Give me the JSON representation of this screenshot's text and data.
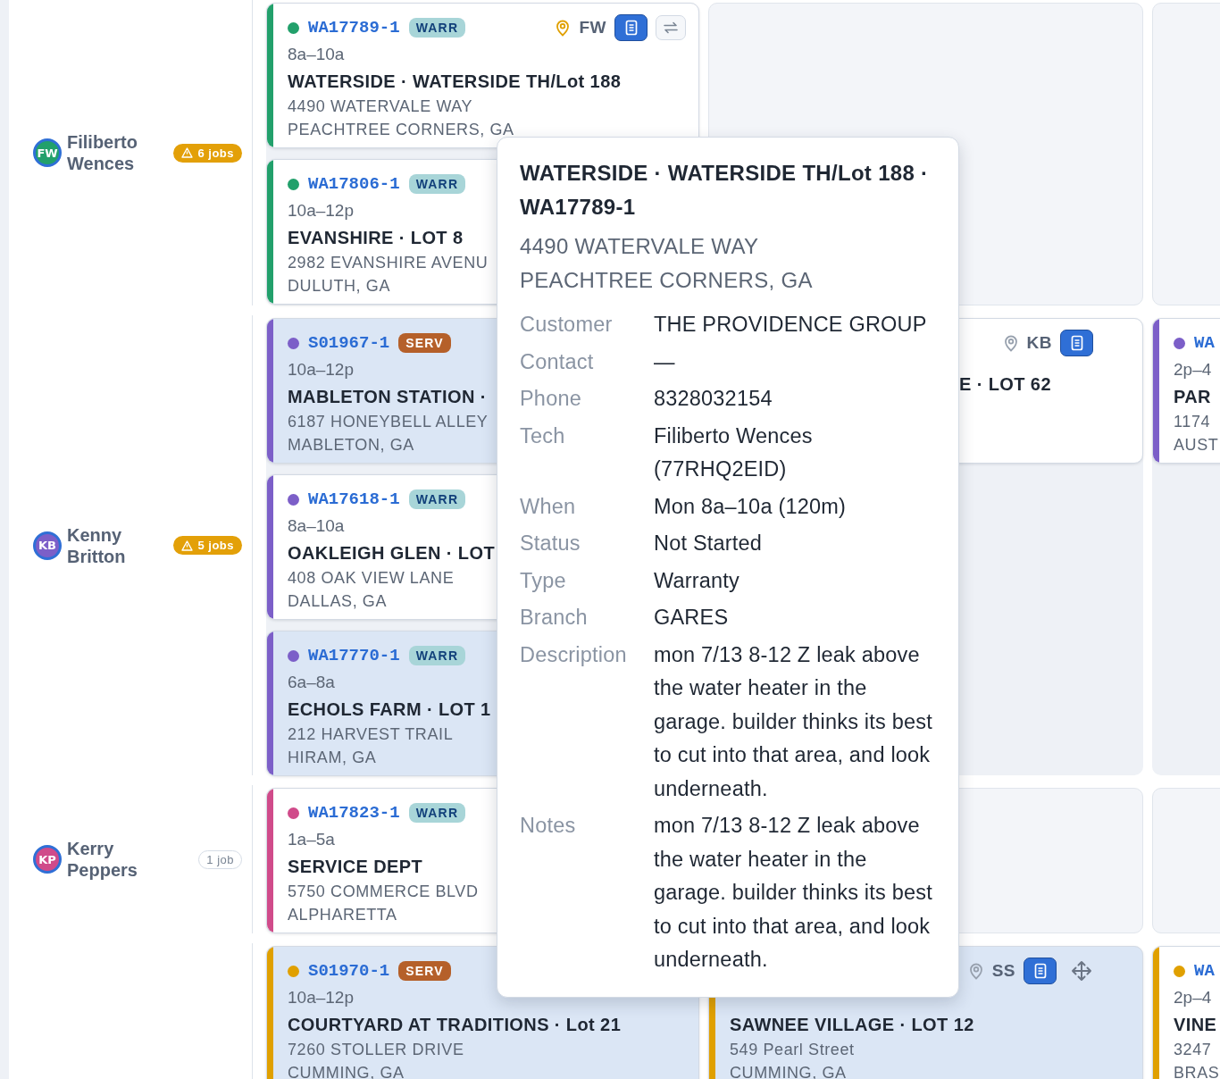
{
  "rows": [
    {
      "tech": {
        "initials": "FW",
        "name": "Filiberto Wences",
        "color": "#22a06b",
        "jobs": "6 jobs",
        "warning": true
      },
      "lane_1": {
        "cards": [
          {
            "id": "WA17789-1",
            "tag": {
              "label": "WARR",
              "kind": "warranty"
            },
            "color": "#22a06b",
            "highlighted": false,
            "pin_alert": true,
            "tech_initials": "FW",
            "tools": [
              {
                "kind": "notes"
              },
              {
                "kind": "swap"
              }
            ],
            "time": "8a–10a",
            "title": "WATERSIDE · WATERSIDE TH/Lot 188",
            "address": "4490 WATERVALE WAY",
            "city": "PEACHTREE CORNERS, GA"
          },
          {
            "id": "WA17806-1",
            "tag": {
              "label": "WARR",
              "kind": "warranty"
            },
            "color": "#22a06b",
            "highlighted": false,
            "time": "10a–12p",
            "title": "EVANSHIRE · LOT 8",
            "address": "2982 EVANSHIRE AVENU",
            "city": "DULUTH, GA"
          }
        ]
      }
    },
    {
      "tech": {
        "initials": "KB",
        "name": "Kenny Britton",
        "color": "#7c5fc8",
        "jobs": "5 jobs",
        "warning": true
      },
      "lane_1": {
        "cards": [
          {
            "id": "S01967-1",
            "tag": {
              "label": "SERV",
              "kind": "service"
            },
            "color": "#7c5fc8",
            "highlighted": true,
            "time": "10a–12p",
            "title": "MABLETON STATION ·",
            "address": "6187 HONEYBELL ALLEY",
            "city": "MABLETON, GA"
          },
          {
            "id": "WA17618-1",
            "tag": {
              "label": "WARR",
              "kind": "warranty"
            },
            "color": "#7c5fc8",
            "highlighted": false,
            "time": "8a–10a",
            "title": "OAKLEIGH GLEN · LOT",
            "address": "408 OAK VIEW LANE",
            "city": "DALLAS, GA"
          },
          {
            "id": "WA17770-1",
            "tag": {
              "label": "WARR",
              "kind": "warranty"
            },
            "color": "#7c5fc8",
            "highlighted": true,
            "time": "6a–8a",
            "title": "ECHOLS FARM · LOT 1",
            "address": "212 HARVEST TRAIL",
            "city": "HIRAM, GA"
          }
        ]
      },
      "lane_2": {
        "cards": [
          {
            "highlighted": false,
            "pin_alert": false,
            "tech_initials": "KB",
            "tools": [
              {
                "kind": "notes"
              }
            ],
            "title": "E · LOT 62"
          }
        ]
      },
      "lane_3": {
        "cards": [
          {
            "id": "WA",
            "color": "#7c5fc8",
            "highlighted": false,
            "time": "2p–4",
            "title": "PAR",
            "address": "1174",
            "city": "AUST"
          }
        ]
      }
    },
    {
      "tech": {
        "initials": "KP",
        "name": "Kerry Peppers",
        "color": "#d04b8a",
        "jobs": "1 job",
        "warning": false
      },
      "lane_1": {
        "cards": [
          {
            "id": "WA17823-1",
            "tag": {
              "label": "WARR",
              "kind": "warranty"
            },
            "color": "#d04b8a",
            "highlighted": false,
            "time": "1a–5a",
            "title": "SERVICE DEPT",
            "address": "5750 COMMERCE BLVD",
            "city": "ALPHARETTA"
          }
        ]
      }
    },
    {
      "lane_1": {
        "cards": [
          {
            "id": "S01970-1",
            "tag": {
              "label": "SERV",
              "kind": "service"
            },
            "color": "#e0a000",
            "highlighted": true,
            "time": "10a–12p",
            "title": "COURTYARD AT TRADITIONS · Lot 21",
            "address": "7260 STOLLER DRIVE",
            "city": "CUMMING, GA"
          }
        ]
      },
      "lane_2": {
        "cards": [
          {
            "color": "#e0a000",
            "highlighted": true,
            "pin_alert": false,
            "tech_initials": "SS",
            "tools": [
              {
                "kind": "notes"
              },
              {
                "kind": "move"
              }
            ],
            "title": "SAWNEE VILLAGE · LOT 12",
            "address": "549 Pearl Street",
            "city": "CUMMING, GA"
          }
        ]
      },
      "lane_3": {
        "cards": [
          {
            "id": "WA",
            "color": "#e0a000",
            "highlighted": false,
            "time": "2p–4",
            "title": "VINE",
            "address": "3247",
            "city": "BRAS"
          }
        ]
      }
    }
  ],
  "tooltip": {
    "title": "WATERSIDE · WATERSIDE TH/Lot 188 · WA17789-1",
    "address": [
      "4490 WATERVALE WAY",
      "PEACHTREE CORNERS, GA"
    ],
    "fields": [
      {
        "label": "Customer",
        "value": "THE PROVIDENCE GROUP"
      },
      {
        "label": "Contact",
        "value": "—"
      },
      {
        "label": "Phone",
        "value": "8328032154"
      },
      {
        "label": "Tech",
        "value": "Filiberto Wences (77RHQ2EID)"
      },
      {
        "label": "When",
        "value": "Mon 8a–10a (120m)"
      },
      {
        "label": "Status",
        "value": "Not Started"
      },
      {
        "label": "Type",
        "value": "Warranty"
      },
      {
        "label": "Branch",
        "value": "GARES"
      },
      {
        "label": "Description",
        "value": "mon 7/13 8-12 Z leak above the water heater in the garage. builder thinks its best to cut into that area, and look underneath."
      },
      {
        "label": "Notes",
        "value": "mon 7/13 8-12 Z leak above the water heater in the garage. builder thinks its best to cut into that area, and look underneath."
      }
    ]
  }
}
